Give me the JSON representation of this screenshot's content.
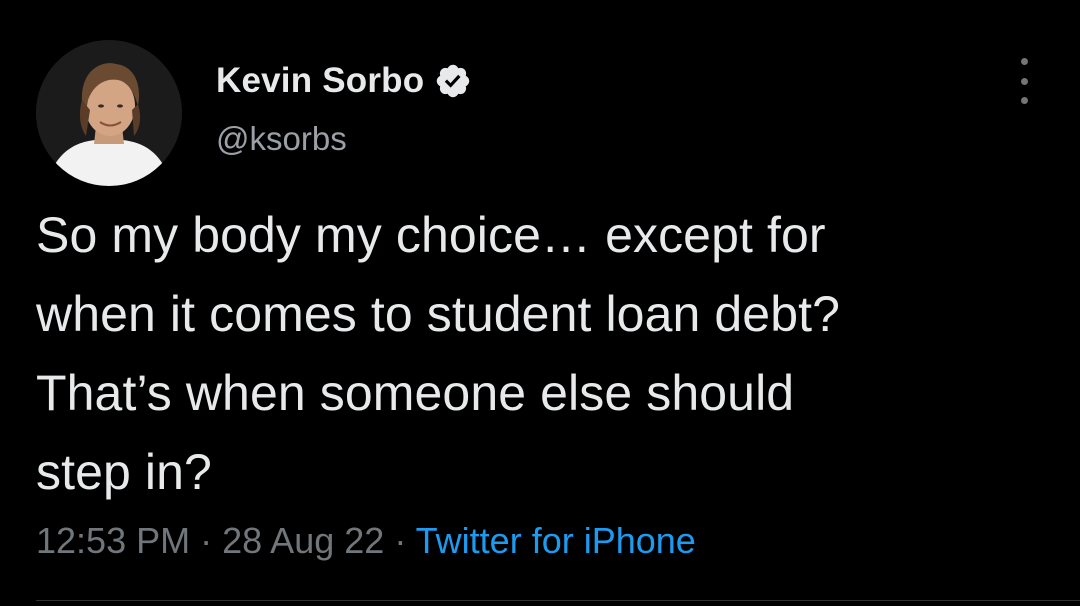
{
  "author": {
    "name": "Kevin Sorbo",
    "handle": "@ksorbs",
    "avatar": "profile-photo",
    "verified_icon": "verified-badge-icon"
  },
  "tweet": {
    "text": "So my body my choice… except for\nwhen it comes to student loan debt?\nThat’s when someone else should\nstep in?",
    "time": "12:53 PM",
    "date": "28 Aug 22",
    "separator": "·",
    "source": "Twitter for iPhone"
  },
  "menu": {
    "icon": "more-options-icon"
  },
  "colors": {
    "background": "#000000",
    "text": "#e7e9ea",
    "secondary": "#71767b",
    "link": "#1d9bf0",
    "verified": "#e7e9ea"
  }
}
